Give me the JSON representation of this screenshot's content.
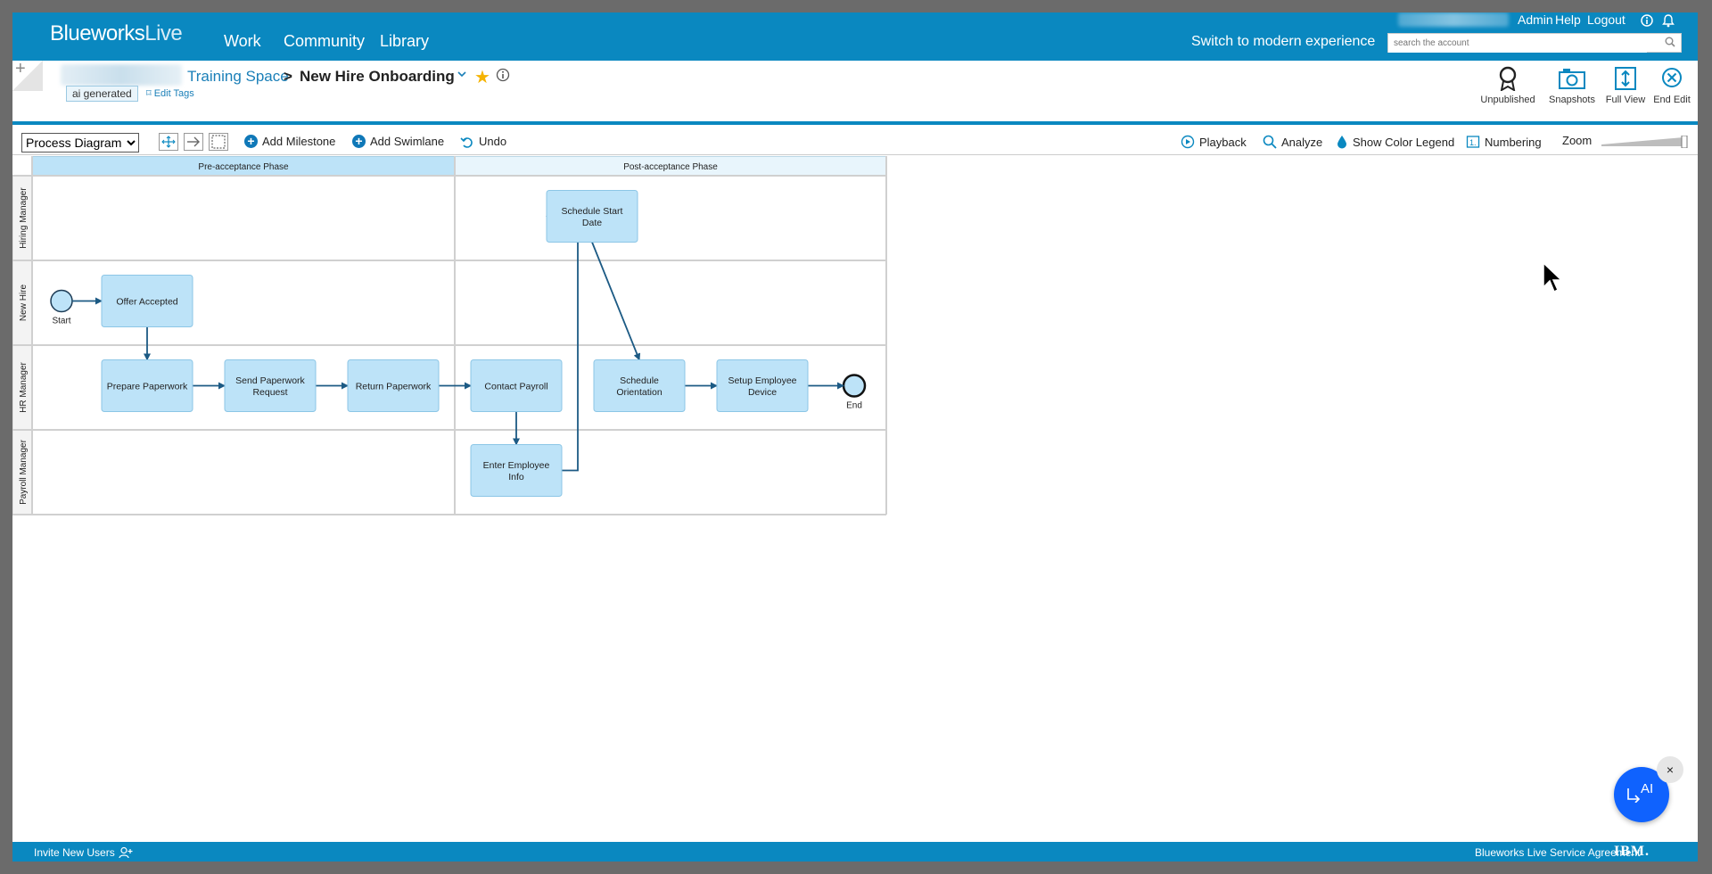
{
  "app": {
    "logo_blue": "Blueworks",
    "logo_live": "Live",
    "nav": [
      "Work",
      "Community",
      "Library"
    ],
    "top_links": [
      "Admin",
      "Help",
      "Logout"
    ],
    "switch_modern": "Switch to modern experience",
    "search_placeholder": "search the account"
  },
  "header": {
    "space": "Training Space",
    "separator": ">",
    "title": "New Hire Onboarding",
    "tag": "ai generated",
    "edit_tags": "Edit Tags",
    "tools": [
      "Unpublished",
      "Snapshots",
      "Full View",
      "End Edit"
    ]
  },
  "toolbar": {
    "diagram_type": "Process Diagram",
    "diagram_options": [
      "Process Diagram"
    ],
    "add_milestone": "Add Milestone",
    "add_swimlane": "Add Swimlane",
    "undo": "Undo",
    "playback": "Playback",
    "analyze": "Analyze",
    "show_color_legend": "Show Color Legend",
    "numbering": "Numbering",
    "zoom": "Zoom"
  },
  "diagram": {
    "milestones": [
      "Pre-acceptance Phase",
      "Post-acceptance Phase"
    ],
    "lanes": [
      "Hiring Manager",
      "New Hire",
      "HR Manager",
      "Payroll Manager"
    ],
    "start_label": "Start",
    "end_label": "End",
    "tasks": [
      {
        "id": "schedule-start-date",
        "lines": [
          "Schedule Start",
          "Date"
        ]
      },
      {
        "id": "offer-accepted",
        "lines": [
          "Offer Accepted"
        ]
      },
      {
        "id": "prepare-paperwork",
        "lines": [
          "Prepare Paperwork"
        ]
      },
      {
        "id": "send-paperwork-request",
        "lines": [
          "Send Paperwork",
          "Request"
        ]
      },
      {
        "id": "return-paperwork",
        "lines": [
          "Return Paperwork"
        ]
      },
      {
        "id": "contact-payroll",
        "lines": [
          "Contact Payroll"
        ]
      },
      {
        "id": "schedule-orientation",
        "lines": [
          "Schedule",
          "Orientation"
        ]
      },
      {
        "id": "setup-employee-device",
        "lines": [
          "Setup Employee",
          "Device"
        ]
      },
      {
        "id": "enter-employee-info",
        "lines": [
          "Enter Employee",
          "Info"
        ]
      }
    ],
    "colors": {
      "task_fill": "#bde3f8",
      "task_stroke": "#8cc6e6",
      "milestone_pre": "#bde3f8",
      "milestone_post": "#e8f5fc",
      "connector": "#1c5a84"
    }
  },
  "footer": {
    "invite": "Invite New Users",
    "sla": "Blueworks Live Service Agreement",
    "ibm": "IBM."
  },
  "ai_fab": {
    "label": "AI",
    "close": "×"
  },
  "colors": {
    "brand": "#0a88c0",
    "accent": "#0f62fe",
    "star": "#f5b301"
  }
}
